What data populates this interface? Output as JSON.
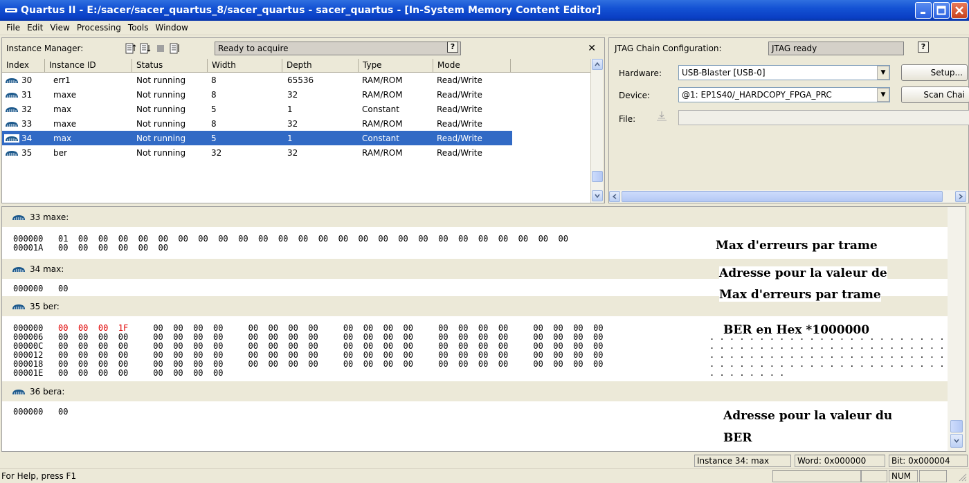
{
  "window": {
    "title": "Quartus II - E:/sacer/sacer_quartus_8/sacer_quartus - sacer_quartus - [In-System Memory Content Editor]"
  },
  "menu": [
    "File",
    "Edit",
    "View",
    "Processing",
    "Tools",
    "Window"
  ],
  "instance_manager": {
    "label": "Instance Manager:",
    "status": "Ready to acquire",
    "columns": [
      "Index",
      "Instance ID",
      "Status",
      "Width",
      "Depth",
      "Type",
      "Mode"
    ],
    "rows": [
      {
        "index": "30",
        "id": "err1",
        "status": "Not running",
        "width": "8",
        "depth": "65536",
        "type": "RAM/ROM",
        "mode": "Read/Write"
      },
      {
        "index": "31",
        "id": "maxe",
        "status": "Not running",
        "width": "8",
        "depth": "32",
        "type": "RAM/ROM",
        "mode": "Read/Write"
      },
      {
        "index": "32",
        "id": "max",
        "status": "Not running",
        "width": "5",
        "depth": "1",
        "type": "Constant",
        "mode": "Read/Write"
      },
      {
        "index": "33",
        "id": "maxe",
        "status": "Not running",
        "width": "8",
        "depth": "32",
        "type": "RAM/ROM",
        "mode": "Read/Write"
      },
      {
        "index": "34",
        "id": "max",
        "status": "Not running",
        "width": "5",
        "depth": "1",
        "type": "Constant",
        "mode": "Read/Write"
      },
      {
        "index": "35",
        "id": "ber",
        "status": "Not running",
        "width": "32",
        "depth": "32",
        "type": "RAM/ROM",
        "mode": "Read/Write"
      }
    ],
    "selected_index": "34"
  },
  "jtag": {
    "label": "JTAG Chain Configuration:",
    "status": "JTAG ready",
    "hardware_label": "Hardware:",
    "hardware_value": "USB-Blaster [USB-0]",
    "setup_button": "Setup...",
    "device_label": "Device:",
    "device_value": "@1: EP1S40/_HARDCOPY_FPGA_PRC",
    "scan_button": "Scan Chai",
    "file_label": "File:",
    "file_value": ""
  },
  "memory": {
    "blocks": [
      {
        "header": "33  maxe:",
        "lines": [
          "000000   01  00  00  00  00  00  00  00  00  00  00  00  00  00  00  00  00  00  00  00  00  00  00  00  00  00",
          "00001A   00  00  00  00  00  00"
        ]
      },
      {
        "header": "34  max:",
        "lines": [
          "000000   00"
        ]
      },
      {
        "header": "35  ber:",
        "lines": [
          "000006   00  00  00  00     00  00  00  00     00  00  00  00     00  00  00  00     00  00  00  00     00  00  00  00",
          "00000C   00  00  00  00     00  00  00  00     00  00  00  00     00  00  00  00     00  00  00  00     00  00  00  00",
          "000012   00  00  00  00     00  00  00  00     00  00  00  00     00  00  00  00     00  00  00  00     00  00  00  00",
          "000018   00  00  00  00     00  00  00  00     00  00  00  00     00  00  00  00     00  00  00  00     00  00  00  00",
          "00001E   00  00  00  00     00  00  00  00"
        ],
        "first_line_addr": "000000",
        "first_line_red": "00  00  00  1F",
        "first_line_rest": "     00  00  00  00     00  00  00  00     00  00  00  00     00  00  00  00     00  00  00  00"
      },
      {
        "header": "36  bera:",
        "lines": [
          "000000   00"
        ]
      }
    ],
    "annotations": [
      "Max d'erreurs par trame",
      "Adresse pour la valeur de",
      "Max d'erreurs par trame",
      "BER en Hex *1000000",
      "Adresse pour la valeur du",
      "BER"
    ]
  },
  "status": {
    "instance": "Instance 34: max",
    "word": "Word: 0x000000",
    "bit": "Bit: 0x000004",
    "help": "For Help, press F1",
    "num": "NUM"
  }
}
